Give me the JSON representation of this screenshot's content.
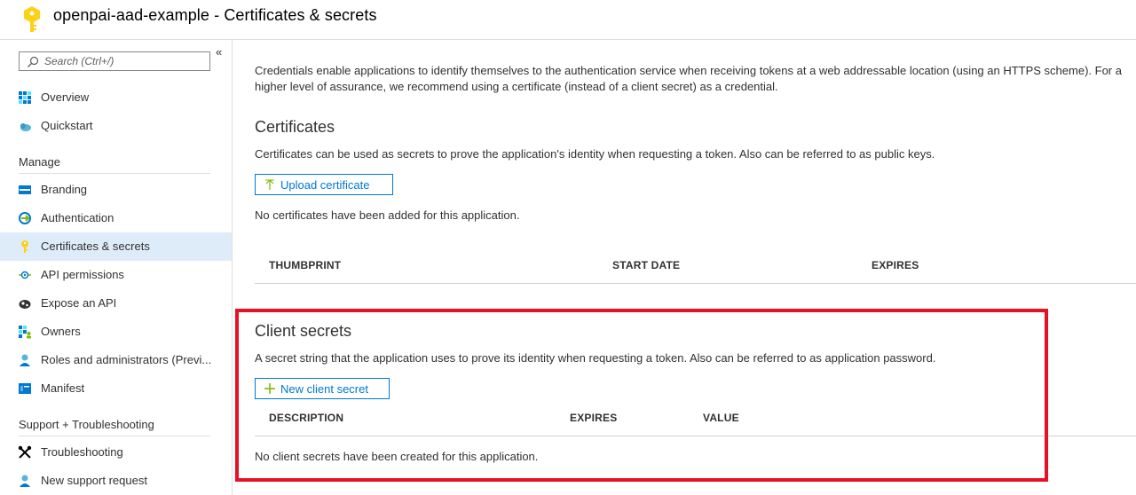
{
  "header": {
    "title": "openpai-aad-example - Certificates & secrets"
  },
  "sidebar": {
    "collapse_glyph": "«",
    "search": {
      "placeholder": "Search (Ctrl+/)"
    },
    "top_items": [
      {
        "label": "Overview",
        "icon": "overview-icon"
      },
      {
        "label": "Quickstart",
        "icon": "quickstart-icon"
      }
    ],
    "manage_heading": "Manage",
    "manage_items": [
      {
        "label": "Branding",
        "icon": "branding-icon"
      },
      {
        "label": "Authentication",
        "icon": "authentication-icon"
      },
      {
        "label": "Certificates & secrets",
        "icon": "key-icon",
        "active": true
      },
      {
        "label": "API permissions",
        "icon": "api-permissions-icon"
      },
      {
        "label": "Expose an API",
        "icon": "expose-api-icon"
      },
      {
        "label": "Owners",
        "icon": "owners-icon"
      },
      {
        "label": "Roles and administrators (Previ...",
        "icon": "roles-icon"
      },
      {
        "label": "Manifest",
        "icon": "manifest-icon"
      }
    ],
    "support_heading": "Support + Troubleshooting",
    "support_items": [
      {
        "label": "Troubleshooting",
        "icon": "wrench-icon"
      },
      {
        "label": "New support request",
        "icon": "support-icon"
      }
    ]
  },
  "main": {
    "intro": "Credentials enable applications to identify themselves to the authentication service when receiving tokens at a web addressable location (using an HTTPS scheme). For a higher level of assurance, we recommend using a certificate (instead of a client secret) as a credential.",
    "certificates": {
      "heading": "Certificates",
      "description": "Certificates can be used as secrets to prove the application's identity when requesting a token. Also can be referred to as public keys.",
      "upload_label": "Upload certificate",
      "empty_text": "No certificates have been added for this application.",
      "columns": [
        "THUMBPRINT",
        "START DATE",
        "EXPIRES"
      ]
    },
    "client_secrets": {
      "heading": "Client secrets",
      "description": "A secret string that the application uses to prove its identity when requesting a token. Also can be referred to as application password.",
      "new_label": "New client secret",
      "columns": [
        "DESCRIPTION",
        "EXPIRES",
        "VALUE"
      ],
      "empty_text": "No client secrets have been created for this application."
    }
  },
  "colors": {
    "accent": "#0078d4",
    "active_bg": "#deecf9",
    "highlight_border": "#e81123",
    "key_yellow": "#fcd116"
  }
}
